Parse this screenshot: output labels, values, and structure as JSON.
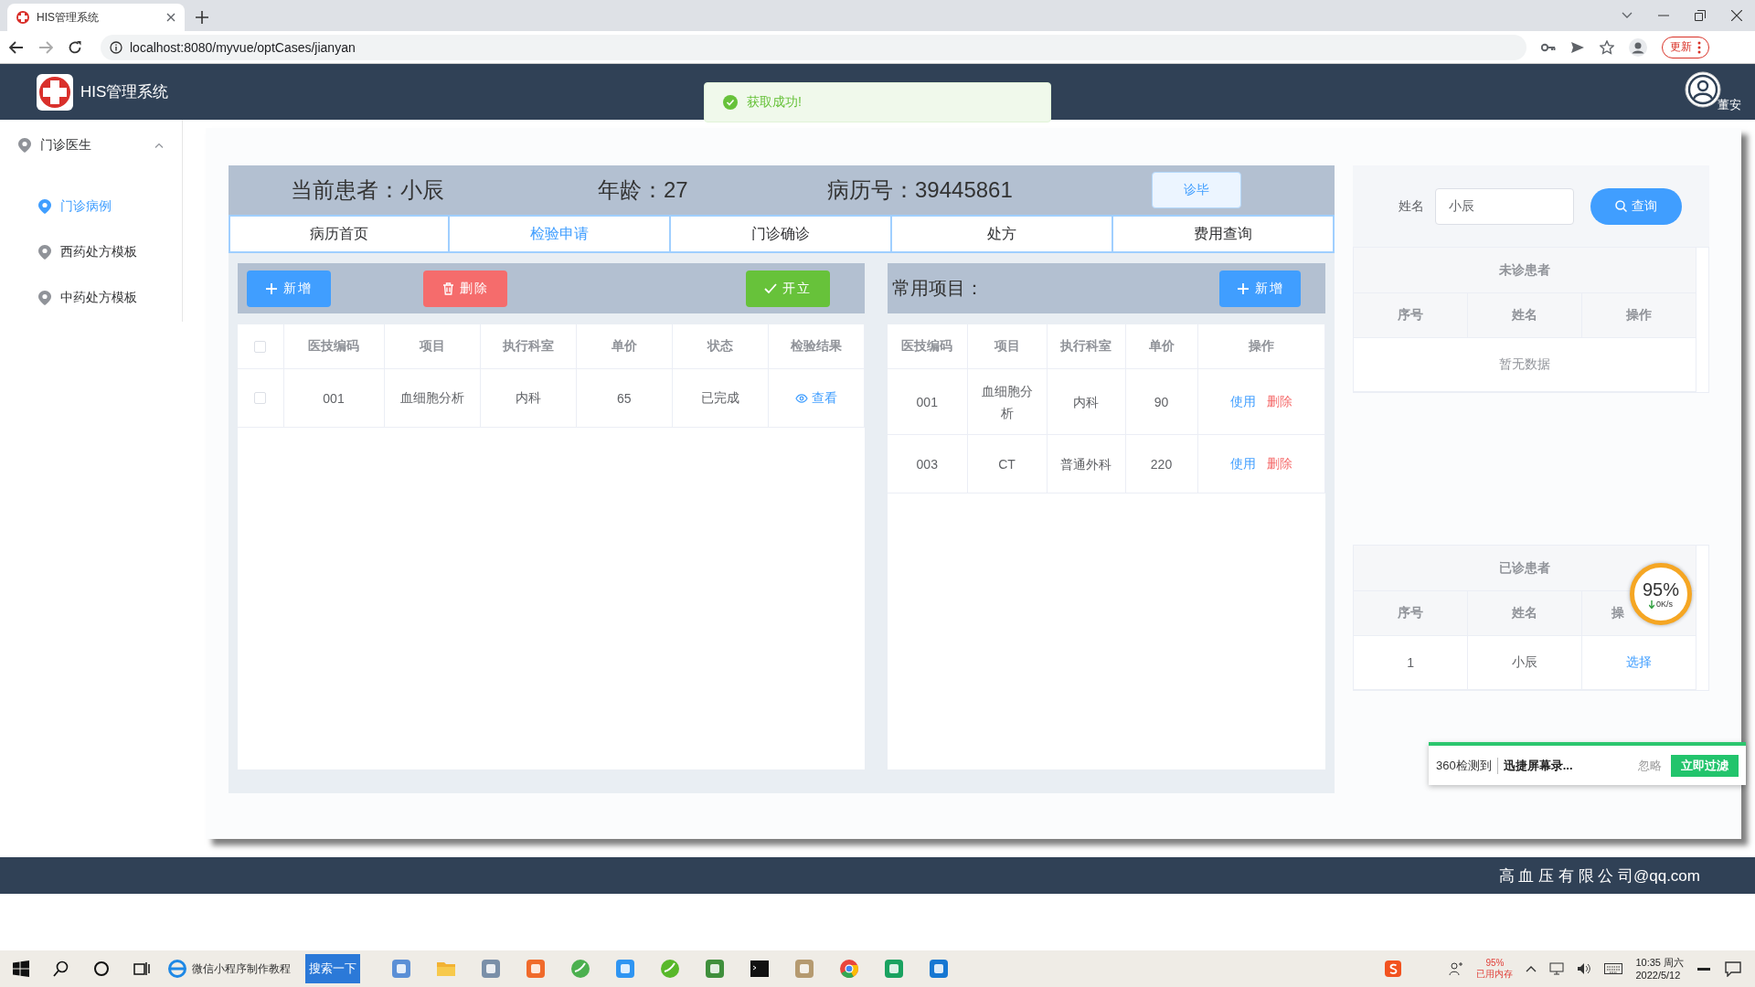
{
  "browser": {
    "tab_title": "HIS管理系统",
    "address": "localhost:8080/myvue/optCases/jianyan",
    "update_button": "更新"
  },
  "header": {
    "app_title": "HIS管理系统",
    "user_name": "董安"
  },
  "toast": {
    "message": "获取成功!"
  },
  "sidebar": {
    "group": {
      "label": "门诊医生",
      "expanded": true,
      "children": [
        {
          "label": "门诊病例",
          "selected": true
        },
        {
          "label": "西药处方模板",
          "selected": false
        },
        {
          "label": "中药处方模板",
          "selected": false
        }
      ]
    }
  },
  "patient_bar": {
    "patient": "当前患者：小辰",
    "age": "年龄：27",
    "record_no": "病历号：39445861",
    "finish_button": "诊毕"
  },
  "tabs": [
    {
      "label": "病历首页",
      "selected": false
    },
    {
      "label": "检验申请",
      "selected": true
    },
    {
      "label": "门诊确诊",
      "selected": false
    },
    {
      "label": "处方",
      "selected": false
    },
    {
      "label": "费用查询",
      "selected": false
    }
  ],
  "exam_panel": {
    "buttons": [
      {
        "kind": "add",
        "label": "新增"
      },
      {
        "kind": "delete",
        "label": "删除"
      },
      {
        "kind": "issue",
        "label": "开立"
      }
    ],
    "table": {
      "select_all_checked": false,
      "columns": [
        "医技编码",
        "项目",
        "执行科室",
        "单价",
        "状态",
        "检验结果"
      ],
      "rows": [
        {
          "checked": false,
          "cells": [
            "001",
            "血细胞分析",
            "内科",
            "65",
            "已完成"
          ],
          "action": "查看"
        }
      ]
    }
  },
  "common_panel": {
    "title": "常用项目：",
    "add_button": "新增",
    "table": {
      "columns": [
        "医技编码",
        "项目",
        "执行科室",
        "单价",
        "操作"
      ],
      "rows": [
        {
          "cells": [
            "001",
            "血细胞分析",
            "内科",
            "90"
          ],
          "actions": [
            "使用",
            "删除"
          ]
        },
        {
          "cells": [
            "003",
            "CT",
            "普通外科",
            "220"
          ],
          "actions": [
            "使用",
            "删除"
          ]
        }
      ]
    }
  },
  "search": {
    "label": "姓名",
    "value": "小辰",
    "button": "查询"
  },
  "waiting_table": {
    "title": "未诊患者",
    "columns": [
      "序号",
      "姓名",
      "操作"
    ],
    "empty_text": "暂无数据"
  },
  "done_table": {
    "title": "已诊患者",
    "columns": [
      "序号",
      "姓名",
      "操"
    ],
    "rows": [
      {
        "cells": [
          "1",
          "小辰"
        ],
        "action": "选择"
      }
    ]
  },
  "footer": {
    "text": "高 血 压 有 限 公 司@qq.com"
  },
  "speed_meter": {
    "percent": "95%",
    "rate": "0K/s"
  },
  "security_popup": {
    "source": "360检测到",
    "app": "迅捷屏幕录...",
    "ignore": "忽略",
    "action": "立即过滤"
  },
  "taskbar": {
    "search_box": "微信小程序制作教程",
    "search_button": "搜索一下",
    "memory_percent": "95%",
    "memory_label": "已用内存",
    "time": "10:35 周六",
    "date": "2022/5/12"
  }
}
